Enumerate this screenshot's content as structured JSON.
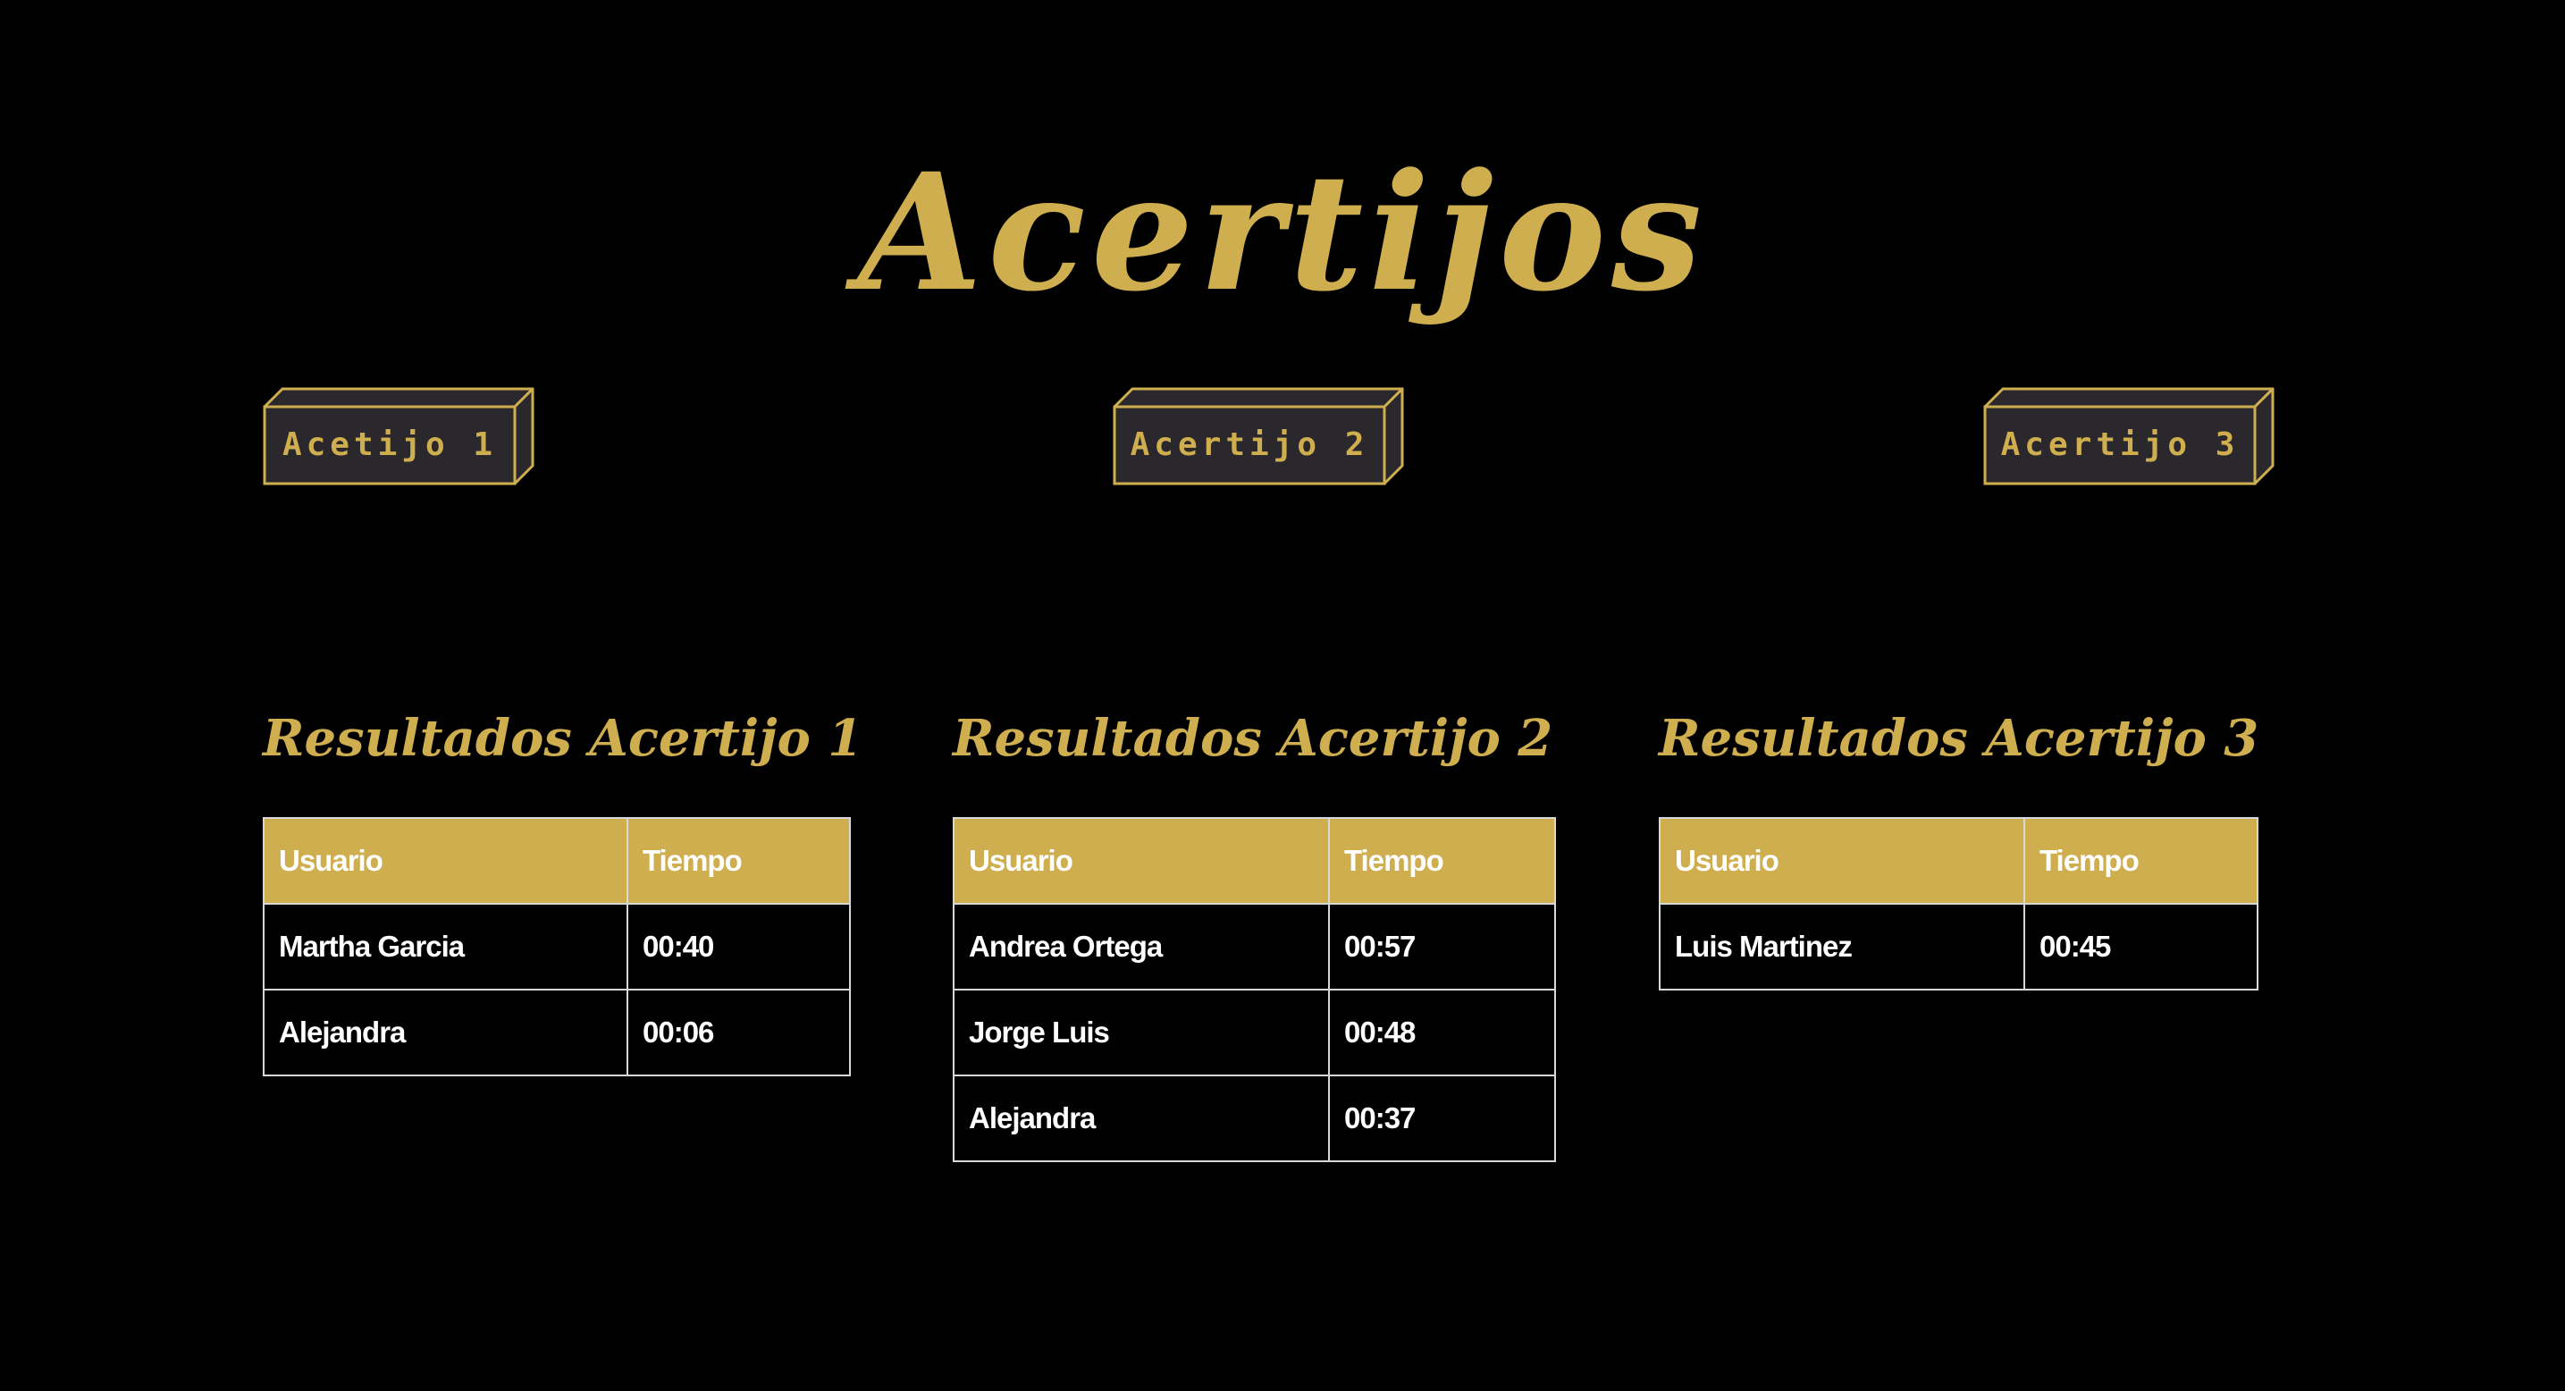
{
  "page": {
    "title": "Acertijos"
  },
  "colors": {
    "background": "#000000",
    "accent": "#cfae4f",
    "button_face": "#2a282c",
    "table_border": "#d8d8d8",
    "text": "#ffffff"
  },
  "buttons": [
    {
      "label": "Acetijo 1"
    },
    {
      "label": "Acertijo 2"
    },
    {
      "label": "Acertijo 3"
    }
  ],
  "results": [
    {
      "title": "Resultados Acertijo 1",
      "headers": [
        "Usuario",
        "Tiempo"
      ],
      "rows": [
        [
          "Martha Garcia",
          "00:40"
        ],
        [
          "Alejandra",
          "00:06"
        ]
      ]
    },
    {
      "title": "Resultados Acertijo 2",
      "headers": [
        "Usuario",
        "Tiempo"
      ],
      "rows": [
        [
          "Andrea Ortega",
          "00:57"
        ],
        [
          "Jorge Luis",
          "00:48"
        ],
        [
          "Alejandra",
          "00:37"
        ]
      ]
    },
    {
      "title": "Resultados Acertijo 3",
      "headers": [
        "Usuario",
        "Tiempo"
      ],
      "rows": [
        [
          "Luis Martinez",
          "00:45"
        ]
      ]
    }
  ]
}
